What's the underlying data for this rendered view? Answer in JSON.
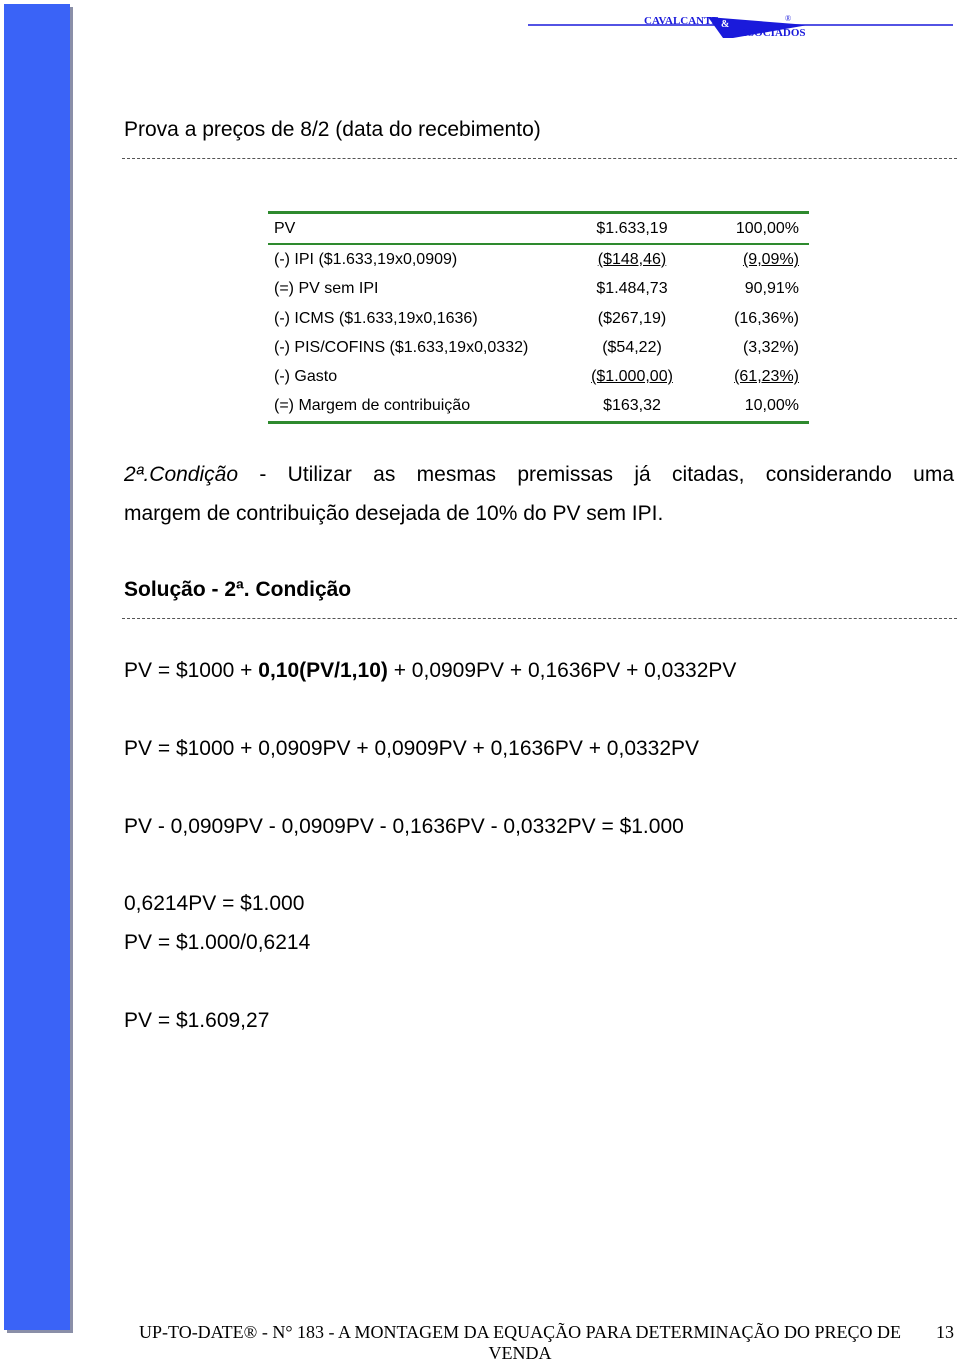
{
  "header": {
    "logo_text_line1": "CAVALCANTE",
    "logo_amp": "&",
    "logo_text_line2": "ASSOCIADOS",
    "logo_reg": "®",
    "brand_color": "#1a1adb"
  },
  "section_title": "Prova a preços de 8/2 (data do recebimento)",
  "table": {
    "rows": [
      {
        "label": "PV",
        "value": "$1.633,19",
        "pct": "100,00%"
      },
      {
        "label": "(-) IPI ($1.633,19x0,0909)",
        "value": "($148,46)",
        "pct": "(9,09%)"
      },
      {
        "label": "(=) PV sem IPI",
        "value": "$1.484,73",
        "pct": "90,91%"
      },
      {
        "label": "(-) ICMS ($1.633,19x0,1636)",
        "value": "($267,19)",
        "pct": "(16,36%)"
      },
      {
        "label": "(-) PIS/COFINS ($1.633,19x0,0332)",
        "value": "($54,22)",
        "pct": "(3,32%)"
      },
      {
        "label": "(-) Gasto",
        "value": "($1.000,00)",
        "pct": "(61,23%)"
      },
      {
        "label": "(=) Margem de contribuição",
        "value": "$163,32",
        "pct": "10,00%"
      }
    ]
  },
  "condition": {
    "label": "2ª.Condição",
    "line1": " - Utilizar as mesmas premissas já citadas, considerando uma",
    "line2": "margem de contribuição desejada de 10% do PV sem IPI."
  },
  "solution_title": "Solução - 2ª. Condição",
  "equations": {
    "eq1_a": "PV = $1000 + ",
    "eq1_b": "0,10(PV/1,10)",
    "eq1_c": " + 0,0909PV + 0,1636PV + 0,0332PV",
    "eq2": "PV = $1000 + 0,0909PV + 0,0909PV + 0,1636PV + 0,0332PV",
    "eq3": "PV - 0,0909PV - 0,0909PV - 0,1636PV - 0,0332PV = $1.000",
    "eq4": "0,6214PV = $1.000",
    "eq5": "PV = $1.000/0,6214",
    "eq6": "PV = $1.609,27"
  },
  "footer": {
    "text": "UP-TO-DATE® - N° 183 - A MONTAGEM DA EQUAÇÃO PARA DETERMINAÇÃO DO PREÇO DE VENDA",
    "page": "13"
  }
}
